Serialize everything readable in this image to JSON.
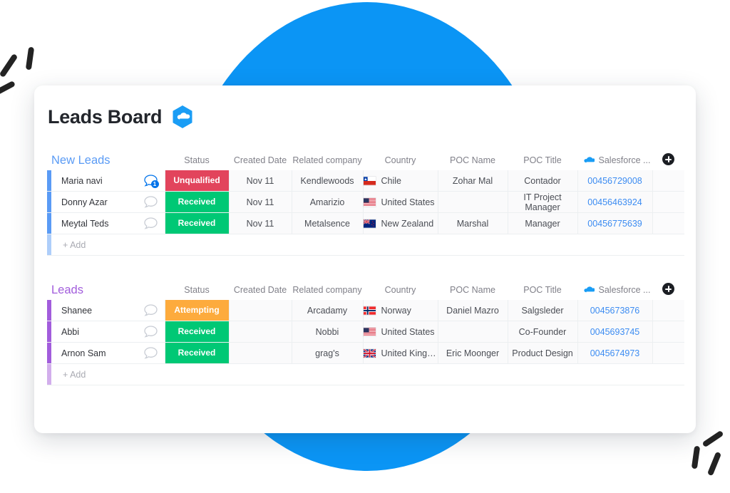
{
  "board": {
    "title": "Leads Board",
    "logo_icon": "salesforce-hexagon-cloud-icon"
  },
  "columns": {
    "status": "Status",
    "created_date": "Created Date",
    "related_company": "Related company",
    "country": "Country",
    "poc_name": "POC Name",
    "poc_title": "POC Title",
    "salesforce": "Salesforce ...",
    "add_column": "add-column-button"
  },
  "colors": {
    "background_circle": "#0b95f5",
    "group_blue": "#5a9bf5",
    "group_purple": "#a25ddc",
    "status_unqualified": "#e2445c",
    "status_received": "#00c875",
    "status_attempting": "#fdab3d",
    "link": "#3c8cf2"
  },
  "groups": [
    {
      "name": "New Leads",
      "color": "#5a9bf5",
      "add_label": "+ Add",
      "rows": [
        {
          "name": "Maria navi",
          "updates": "1",
          "status": "Unqualified",
          "status_color": "#e2445c",
          "created_date": "Nov 11",
          "related_company": "Kendlewoods",
          "country": "Chile",
          "flag": "flag-chile",
          "poc_name": "Zohar Mal",
          "poc_title": "Contador",
          "salesforce": "00456729008"
        },
        {
          "name": "Donny Azar",
          "updates": "",
          "status": "Received",
          "status_color": "#00c875",
          "created_date": "Nov 11",
          "related_company": "Amarizio",
          "country": "United States",
          "flag": "flag-united-states",
          "poc_name": "",
          "poc_title": "IT Project Manager",
          "salesforce": "00456463924"
        },
        {
          "name": "Meytal Teds",
          "updates": "",
          "status": "Received",
          "status_color": "#00c875",
          "created_date": "Nov 11",
          "related_company": "Metalsence",
          "country": "New Zealand",
          "flag": "flag-new-zealand",
          "poc_name": "Marshal",
          "poc_title": "Manager",
          "salesforce": "00456775639"
        }
      ]
    },
    {
      "name": "Leads",
      "color": "#a25ddc",
      "add_label": "+ Add",
      "rows": [
        {
          "name": "Shanee",
          "updates": "",
          "status": "Attempting",
          "status_color": "#fdab3d",
          "created_date": "",
          "related_company": "Arcadamy",
          "country": "Norway",
          "flag": "flag-norway",
          "poc_name": "Daniel Mazro",
          "poc_title": "Salgsleder",
          "salesforce": "0045673876"
        },
        {
          "name": "Abbi",
          "updates": "",
          "status": "Received",
          "status_color": "#00c875",
          "created_date": "",
          "related_company": "Nobbi",
          "country": "United States",
          "flag": "flag-united-states",
          "poc_name": "",
          "poc_title": "Co-Founder",
          "salesforce": "0045693745"
        },
        {
          "name": "Arnon Sam",
          "updates": "",
          "status": "Received",
          "status_color": "#00c875",
          "created_date": "",
          "related_company": "grag's",
          "country": "United Kingd...",
          "flag": "flag-united-kingdom",
          "poc_name": "Eric Moonger",
          "poc_title": "Product Design",
          "salesforce": "0045674973"
        }
      ]
    }
  ]
}
